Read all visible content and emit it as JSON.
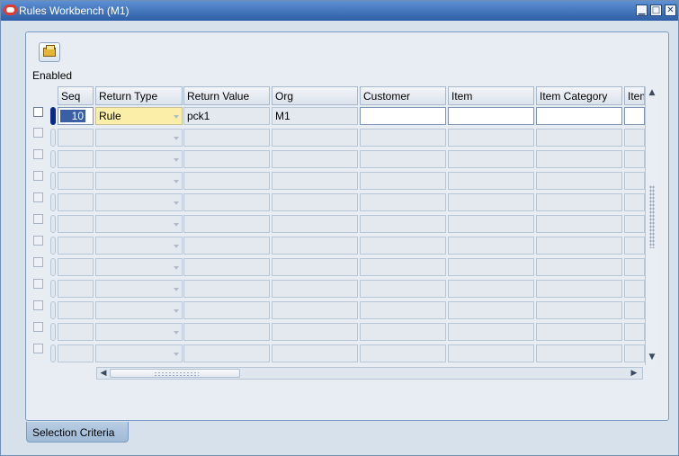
{
  "window": {
    "title": "Rules Workbench (M1)",
    "controls": [
      "minimize-icon",
      "maximize-icon",
      "close-icon"
    ]
  },
  "toolbar": {
    "open_icon": "folder-open-icon"
  },
  "grid": {
    "enabled_label": "Enabled",
    "columns": [
      "Seq",
      "Return Type",
      "Return Value",
      "Org",
      "Customer",
      "Item",
      "Item Category",
      "Item"
    ],
    "rows": [
      {
        "seq": "10",
        "return_type": "Rule",
        "return_value": "pck1",
        "org": "M1",
        "customer": "",
        "item": "",
        "item_category": "",
        "item2": ""
      }
    ],
    "empty_row_count": 11
  },
  "tabs": [
    {
      "label": "Selection Criteria"
    }
  ],
  "colors": {
    "title_bar": "#3f70b3",
    "active_indicator": "#0b2a88",
    "required_field": "#fbeea9"
  }
}
